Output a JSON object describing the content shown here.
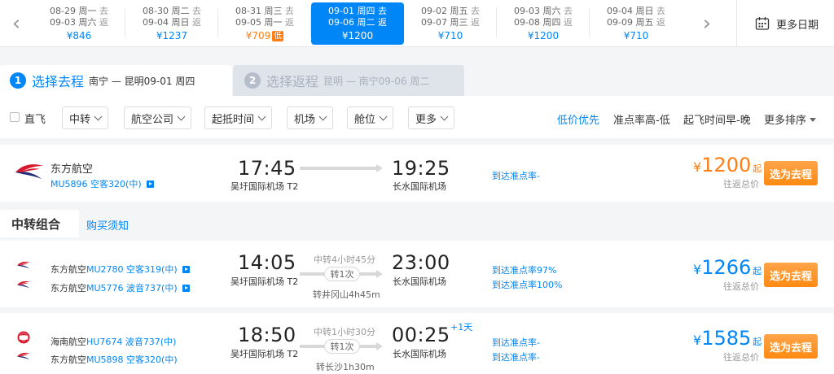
{
  "date_bar": {
    "cells": [
      {
        "out_date": "08-29",
        "out_day": "周一",
        "out_tag": "去",
        "ret_date": "09-03",
        "ret_day": "周六",
        "ret_tag": "返",
        "price": "¥846"
      },
      {
        "out_date": "08-30",
        "out_day": "周二",
        "out_tag": "去",
        "ret_date": "09-04",
        "ret_day": "周日",
        "ret_tag": "返",
        "price": "¥1237"
      },
      {
        "out_date": "08-31",
        "out_day": "周三",
        "out_tag": "去",
        "ret_date": "09-05",
        "ret_day": "周一",
        "ret_tag": "返",
        "price": "¥709",
        "badge": "低"
      },
      {
        "out_date": "09-01",
        "out_day": "周四",
        "out_tag": "去",
        "ret_date": "09-06",
        "ret_day": "周二",
        "ret_tag": "返",
        "price": "¥1200"
      },
      {
        "out_date": "09-02",
        "out_day": "周五",
        "out_tag": "去",
        "ret_date": "09-07",
        "ret_day": "周三",
        "ret_tag": "返",
        "price": "¥710"
      },
      {
        "out_date": "09-03",
        "out_day": "周六",
        "out_tag": "去",
        "ret_date": "09-08",
        "ret_day": "周四",
        "ret_tag": "返",
        "price": "¥1200"
      },
      {
        "out_date": "09-04",
        "out_day": "周日",
        "out_tag": "去",
        "ret_date": "09-09",
        "ret_day": "周五",
        "ret_tag": "返",
        "price": "¥710"
      }
    ],
    "more_label": "更多日期"
  },
  "steps": [
    {
      "num": "1",
      "title": "选择去程",
      "route": "南宁 — 昆明09-01 周四"
    },
    {
      "num": "2",
      "title": "选择返程",
      "route": "昆明 — 南宁09-06 周二"
    }
  ],
  "filters": {
    "direct_label": "直飞",
    "buttons": [
      "中转",
      "航空公司",
      "起抵时间",
      "机场",
      "舱位",
      "更多"
    ],
    "sorts": [
      "低价优先",
      "准点率高-低",
      "起飞时间早-晚",
      "更多排序"
    ]
  },
  "direct_flight": {
    "airline": "东方航空",
    "flight": "MU5896 空客320(中)",
    "dep_time": "17:45",
    "dep_airport": "吴圩国际机场 T2",
    "arr_time": "19:25",
    "arr_airport": "长水国际机场",
    "ontime": "到达准点率-",
    "price_cur": "¥",
    "price_num": "1200",
    "price_suffix": "起",
    "price_note": "往返总价",
    "select_label": "选为去程"
  },
  "transfer_section": {
    "title": "中转组合",
    "link": "购买须知"
  },
  "transfer_flights": [
    {
      "legs": [
        {
          "airline": "东方航空",
          "flight": "MU2780 空客319(中)"
        },
        {
          "airline": "东方航空",
          "flight": "MU5776 波音737(中)"
        }
      ],
      "dep_time": "14:05",
      "dep_airport": "吴圩国际机场 T2",
      "transfer_info": "中转4小时45分",
      "transfer_count": "转1次",
      "transfer_city": "转井冈山4h45m",
      "arr_time": "23:00",
      "arr_airport": "长水国际机场",
      "plus_day": "",
      "ontime": [
        "到达准点率97%",
        "到达准点率100%"
      ],
      "price_cur": "¥",
      "price_num": "1266",
      "price_suffix": "起",
      "price_note": "往返总价",
      "select_label": "选为去程"
    },
    {
      "legs": [
        {
          "airline": "海南航空",
          "flight": "HU7674 波音737(中)"
        },
        {
          "airline": "东方航空",
          "flight": "MU5898 空客320(中)"
        }
      ],
      "dep_time": "18:50",
      "dep_airport": "吴圩国际机场 T2",
      "transfer_info": "中转1小时30分",
      "transfer_count": "转1次",
      "transfer_city": "转长沙1h30m",
      "arr_time": "00:25",
      "arr_airport": "长水国际机场",
      "plus_day": "+1天",
      "ontime": [
        "到达准点率-",
        "到达准点率-"
      ],
      "price_cur": "¥",
      "price_num": "1585",
      "price_suffix": "起",
      "price_note": "往返总价",
      "select_label": "选为去程"
    }
  ],
  "icons": {
    "prev": "chevron-left-icon",
    "next": "chevron-right-icon",
    "calendar": "calendar-icon",
    "play": "play-icon",
    "eastern_logo": "china-eastern-logo-icon",
    "hainan_logo": "hainan-airlines-logo-icon"
  },
  "colors": {
    "accent": "#0086f6",
    "price_orange": "#ff7d13",
    "button_orange": "#ff8a12",
    "eastern_red": "#d7192c",
    "eastern_navy": "#1c2e7a"
  }
}
